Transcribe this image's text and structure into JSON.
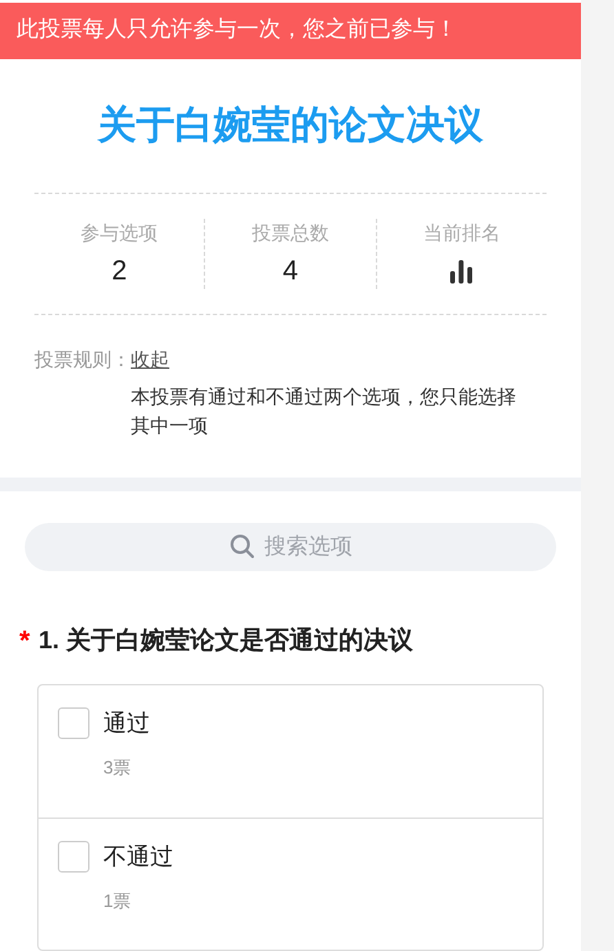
{
  "notice": "此投票每人只允许参与一次，您之前已参与！",
  "title": "关于白婉莹的论文决议",
  "stats": [
    {
      "kind": "number",
      "label": "参与选项",
      "value": "2"
    },
    {
      "kind": "number",
      "label": "投票总数",
      "value": "4"
    },
    {
      "kind": "icon",
      "label": "当前排名"
    }
  ],
  "rules": {
    "label": "投票规则：",
    "toggle": "收起",
    "text": "本投票有通过和不通过两个选项，您只能选择其中一项"
  },
  "search": {
    "placeholder": "搜索选项"
  },
  "question": {
    "required": true,
    "required_mark": "*",
    "title": "1. 关于白婉莹论文是否通过的决议",
    "options": [
      {
        "label": "通过",
        "votes": "3票",
        "checked": false
      },
      {
        "label": "不通过",
        "votes": "1票",
        "checked": false
      }
    ]
  }
}
